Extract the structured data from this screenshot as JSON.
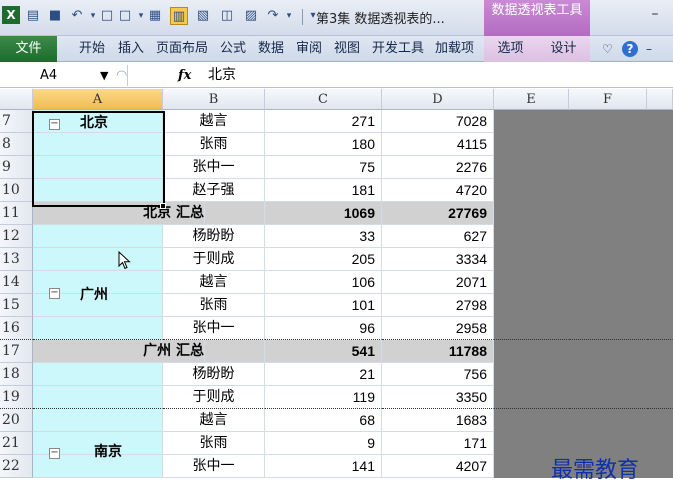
{
  "titlebar": {
    "app_icon": "X",
    "title": "第3集 数据透视表的...",
    "context_tool_label": "数据透视表工具",
    "minimize": "–"
  },
  "ribbon": {
    "tabs": [
      {
        "label": "文件"
      },
      {
        "label": "开始"
      },
      {
        "label": "插入"
      },
      {
        "label": "页面布局"
      },
      {
        "label": "公式"
      },
      {
        "label": "数据"
      },
      {
        "label": "审阅"
      },
      {
        "label": "视图"
      },
      {
        "label": "开发工具"
      },
      {
        "label": "加载项"
      },
      {
        "label": "选项"
      },
      {
        "label": "设计"
      }
    ],
    "caret": "♡",
    "help": "?",
    "more": "–"
  },
  "formula_bar": {
    "name_box": "A4",
    "name_drop": "▼",
    "fx": "fx",
    "content": "北京"
  },
  "columns": [
    "A",
    "B",
    "C",
    "D",
    "E",
    "F"
  ],
  "rows": [
    {
      "n": "7",
      "name": "越言",
      "c": "271",
      "d": "7028"
    },
    {
      "n": "8",
      "name": "张雨",
      "c": "180",
      "d": "4115"
    },
    {
      "n": "9",
      "name": "张中一",
      "c": "75",
      "d": "2276"
    },
    {
      "n": "10",
      "name": "赵子强",
      "c": "181",
      "d": "4720"
    },
    {
      "n": "11",
      "subtotal": "北京 汇总",
      "c": "1069",
      "d": "27769"
    },
    {
      "n": "12",
      "name": "杨盼盼",
      "c": "33",
      "d": "627"
    },
    {
      "n": "13",
      "name": "于则成",
      "c": "205",
      "d": "3334"
    },
    {
      "n": "14",
      "name": "越言",
      "c": "106",
      "d": "2071"
    },
    {
      "n": "15",
      "name": "张雨",
      "c": "101",
      "d": "2798"
    },
    {
      "n": "16",
      "name": "张中一",
      "c": "96",
      "d": "2958"
    },
    {
      "n": "17",
      "subtotal": "广州 汇总",
      "c": "541",
      "d": "11788"
    },
    {
      "n": "18",
      "name": "杨盼盼",
      "c": "21",
      "d": "756"
    },
    {
      "n": "19",
      "name": "于则成",
      "c": "119",
      "d": "3350"
    },
    {
      "n": "20",
      "name": "越言",
      "c": "68",
      "d": "1683"
    },
    {
      "n": "21",
      "name": "张雨",
      "c": "9",
      "d": "171"
    },
    {
      "n": "22",
      "name": "张中一",
      "c": "141",
      "d": "4207"
    }
  ],
  "groups": [
    {
      "city": "北京",
      "toggle": "⊟"
    },
    {
      "city": "广州",
      "toggle": "⊟"
    },
    {
      "city": "南京",
      "toggle": "⊟"
    }
  ],
  "watermark": "最需教育",
  "colors": {
    "pivot_item_fill": "#ccf7fb",
    "subtotal_fill": "#d1d1d1",
    "outside_fill": "#808080",
    "context_tab": "#b36bc1",
    "file_tab": "#1f6a2c",
    "watermark": "#1030a8"
  }
}
